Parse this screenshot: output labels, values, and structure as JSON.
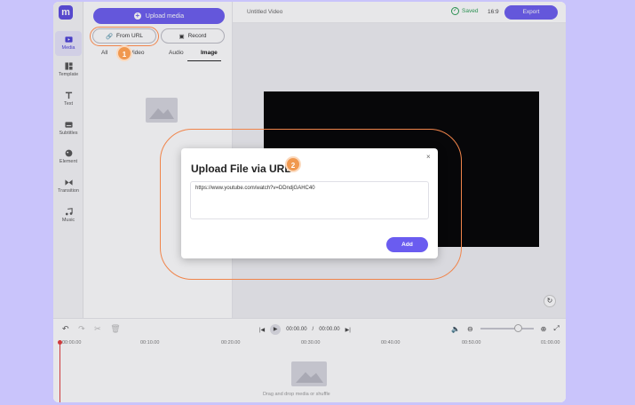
{
  "app": {
    "logo_letter": "m",
    "project_title": "Untitled Video",
    "saved_label": "Saved",
    "aspect_ratio": "16:9",
    "export_label": "Export"
  },
  "sidebar": {
    "items": [
      {
        "label": "Media",
        "icon": "media-icon"
      },
      {
        "label": "Template",
        "icon": "template-icon"
      },
      {
        "label": "Text",
        "icon": "text-icon"
      },
      {
        "label": "Subtitles",
        "icon": "subtitles-icon"
      },
      {
        "label": "Element",
        "icon": "element-icon"
      },
      {
        "label": "Transition",
        "icon": "transition-icon"
      },
      {
        "label": "Music",
        "icon": "music-icon"
      }
    ]
  },
  "media_panel": {
    "upload_label": "Upload media",
    "from_url_label": "From URL",
    "record_label": "Record",
    "tabs": [
      "All",
      "Video",
      "Audio",
      "Image"
    ],
    "active_tab": "Image"
  },
  "timeline": {
    "current_time": "00:00.00",
    "total_time": "00:00.00",
    "separator": "/",
    "ruler": [
      "00:00.00",
      "00:10.00",
      "00:20.00",
      "00:30.00",
      "00:40.00",
      "00:50.00",
      "01:00.00"
    ],
    "drag_hint": "Drag and drop media or shuffle"
  },
  "modal": {
    "title": "Upload File via URL",
    "url_value": "https://www.youtube.com/watch?v=DDndjGAHC40",
    "add_label": "Add",
    "close_glyph": "×"
  },
  "steps": {
    "step1": "1",
    "step2": "2"
  },
  "colors": {
    "accent": "#6a5cf0",
    "highlight": "#f0844a",
    "background": "#c9c4fb"
  }
}
